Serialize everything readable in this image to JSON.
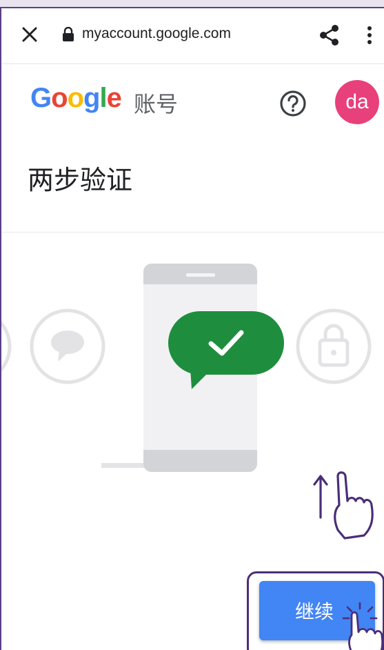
{
  "browser": {
    "url": "myaccount.google.com",
    "icons": [
      "close-icon",
      "lock-icon",
      "share-icon",
      "more-vert-icon"
    ]
  },
  "header": {
    "logo_letters": [
      "G",
      "o",
      "o",
      "g",
      "l",
      "e"
    ],
    "logo_colors": [
      "#4285f4",
      "#ea4335",
      "#fbbc05",
      "#4285f4",
      "#34a853",
      "#ea4335"
    ],
    "account_label": "账号",
    "avatar_initials": "da",
    "avatar_color": "#e8407a"
  },
  "page": {
    "title": "两步验证"
  },
  "illustration": {
    "icons": [
      "phone-icon",
      "chat-bubble-icon",
      "checkmark-icon",
      "lock-icon",
      "message-icon"
    ],
    "accent_green": "#1e8e3e"
  },
  "actions": {
    "continue_label": "继续",
    "button_color": "#4285f4"
  },
  "annotations": {
    "icons": [
      "swipe-up-hand-icon",
      "tap-hand-icon"
    ],
    "color": "#4a2e78"
  }
}
